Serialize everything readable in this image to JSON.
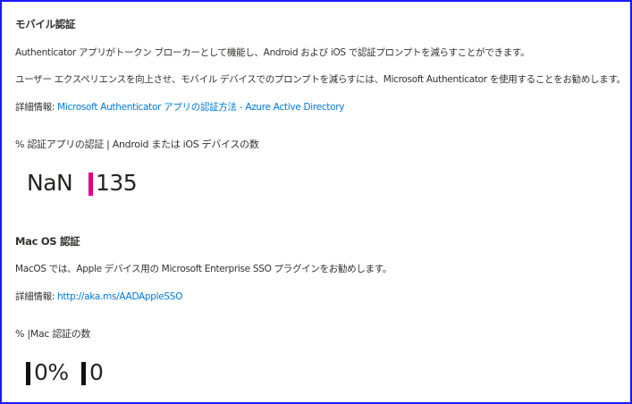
{
  "mobile": {
    "title": "モバイル認証",
    "desc1": "Authenticator アプリがトークン ブローカーとして機能し、Android および iOS で認証プロンプトを減らすことができます。",
    "desc2": "ユーザー エクスペリエンスを向上させ、モバイル デバイスでのプロンプトを減らすには、Microsoft Authenticator を使用することをお勧めします。",
    "more_label": "詳細情報: ",
    "more_link": "Microsoft Authenticator アプリの認証方法 - Azure Active Directory",
    "metric_label": "% 認証アプリの認証 | Android または iOS デバイスの数",
    "percent_value": "NaN",
    "count_value": "135",
    "accent": "#e3008c"
  },
  "mac": {
    "title": "Mac OS 認証",
    "desc": "MacOS では、Apple デバイス用の Microsoft Enterprise SSO プラグインをお勧めします。",
    "more_label": "詳細情報: ",
    "more_link": "http://aka.ms/AADAppleSSO",
    "metric_label": "% |Mac 認証の数",
    "percent_value": "0%",
    "count_value": "0",
    "accent": "#111111"
  }
}
